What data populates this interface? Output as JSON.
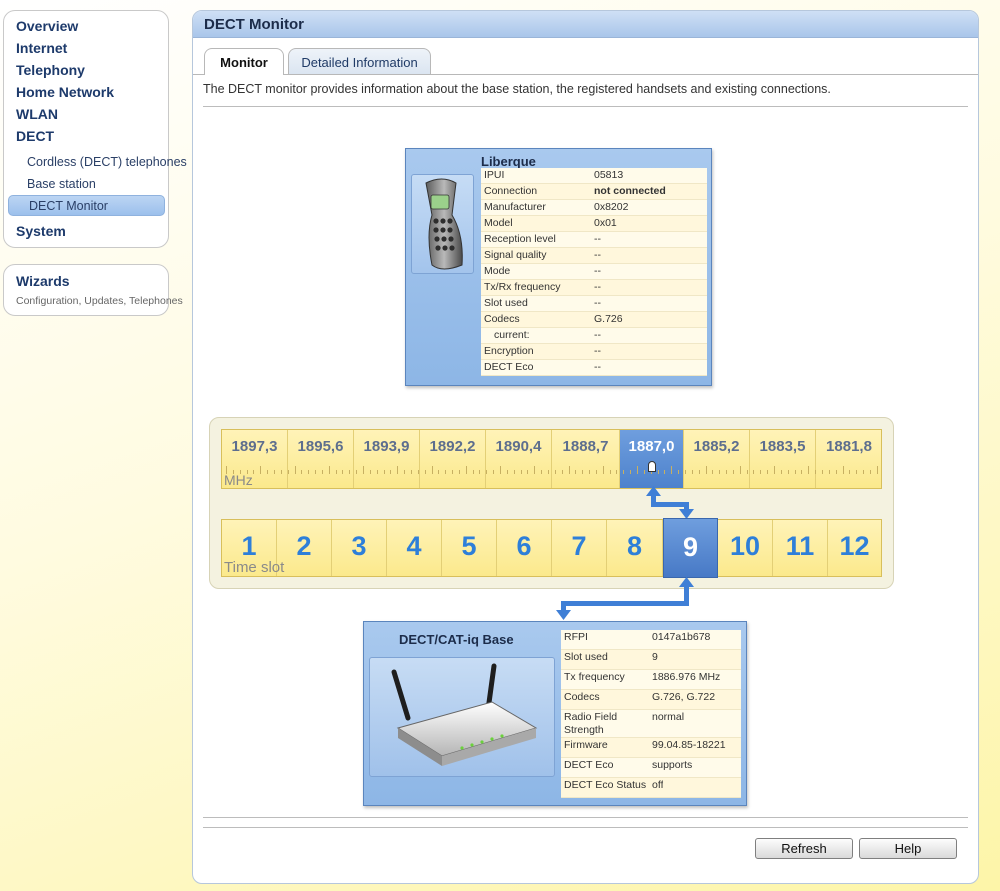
{
  "nav": {
    "items": [
      {
        "label": "Overview"
      },
      {
        "label": "Internet"
      },
      {
        "label": "Telephony"
      },
      {
        "label": "Home Network"
      },
      {
        "label": "WLAN"
      },
      {
        "label": "DECT"
      }
    ],
    "dect_sub": [
      {
        "label": "Cordless (DECT) telephones"
      },
      {
        "label": "Base station"
      },
      {
        "label": "DECT Monitor"
      }
    ],
    "system": "System",
    "wizards": {
      "title": "Wizards",
      "subtitle": "Configuration, Updates, Telephones"
    }
  },
  "page": {
    "title": "DECT Monitor",
    "tabs": [
      {
        "label": "Monitor",
        "active": true
      },
      {
        "label": "Detailed Information",
        "active": false
      }
    ],
    "description": "The DECT monitor provides information about the base station, the registered handsets and existing connections."
  },
  "handset": {
    "name": "Liberque",
    "rows": [
      {
        "label": "IPUI",
        "value": "05813"
      },
      {
        "label": "Connection",
        "value": "not connected"
      },
      {
        "label": "Manufacturer",
        "value": "0x8202"
      },
      {
        "label": "Model",
        "value": "0x01"
      },
      {
        "label": "Reception level",
        "value": "--"
      },
      {
        "label": "Signal quality",
        "value": "--"
      },
      {
        "label": "Mode",
        "value": "--"
      },
      {
        "label": "Tx/Rx frequency",
        "value": "--"
      },
      {
        "label": "Slot used",
        "value": "--"
      },
      {
        "label": "Codecs",
        "value": "G.726"
      },
      {
        "label": "   current:",
        "value": "--"
      },
      {
        "label": "Encryption",
        "value": "--"
      },
      {
        "label": "DECT Eco",
        "value": "--"
      }
    ]
  },
  "frequency": {
    "unit": "MHz",
    "values": [
      "1897,3",
      "1895,6",
      "1893,9",
      "1892,2",
      "1890,4",
      "1888,7",
      "1887,0",
      "1885,2",
      "1883,5",
      "1881,8"
    ],
    "active_index": 6
  },
  "timeslot": {
    "label": "Time slot",
    "values": [
      "1",
      "2",
      "3",
      "4",
      "5",
      "6",
      "7",
      "8",
      "9",
      "10",
      "11",
      "12"
    ],
    "active_index": 8
  },
  "base": {
    "name": "DECT/CAT-iq Base",
    "rows": [
      {
        "label": "RFPI",
        "value": "0147a1b678"
      },
      {
        "label": "Slot used",
        "value": "9"
      },
      {
        "label": "Tx frequency",
        "value": "1886.976 MHz"
      },
      {
        "label": "Codecs",
        "value": "G.726, G.722"
      },
      {
        "label": "Radio Field Strength",
        "value": "normal"
      },
      {
        "label": "Firmware",
        "value": "99.04.85-18221"
      },
      {
        "label": "DECT Eco",
        "value": "supports"
      },
      {
        "label": "DECT Eco Status",
        "value": "off"
      }
    ]
  },
  "buttons": {
    "refresh": "Refresh",
    "help": "Help"
  },
  "colors": {
    "accent": "#4d82cc",
    "slot_text": "#2e7fd9",
    "panel_header": "#a9c6ea"
  }
}
